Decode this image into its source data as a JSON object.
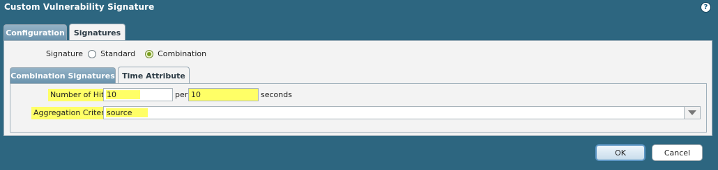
{
  "dialog": {
    "title": "Custom Vulnerability Signature",
    "help_icon": "?"
  },
  "tabs": [
    {
      "label": "Configuration",
      "active": false
    },
    {
      "label": "Signatures",
      "active": true
    }
  ],
  "signature": {
    "label": "Signature",
    "options": [
      {
        "label": "Standard",
        "selected": false
      },
      {
        "label": "Combination",
        "selected": true
      }
    ]
  },
  "inner_tabs": [
    {
      "label": "Combination Signatures",
      "active": false
    },
    {
      "label": "Time Attribute",
      "active": true
    }
  ],
  "time_attribute": {
    "hits_label": "Number of Hits",
    "hits_value": "10",
    "per_label": "per",
    "seconds_value": "10",
    "seconds_label": "seconds",
    "aggregation_label": "Aggregation Criteria",
    "aggregation_value": "source"
  },
  "buttons": {
    "ok": "OK",
    "cancel": "Cancel"
  },
  "colors": {
    "background": "#2d6680",
    "panel": "#f3f3f3",
    "highlight": "#ffff66",
    "tab_inactive": "#6a93ad",
    "ok_border": "#5b95c4"
  },
  "icons": {
    "help": "help-icon",
    "dropdown": "chevron-down-icon"
  }
}
